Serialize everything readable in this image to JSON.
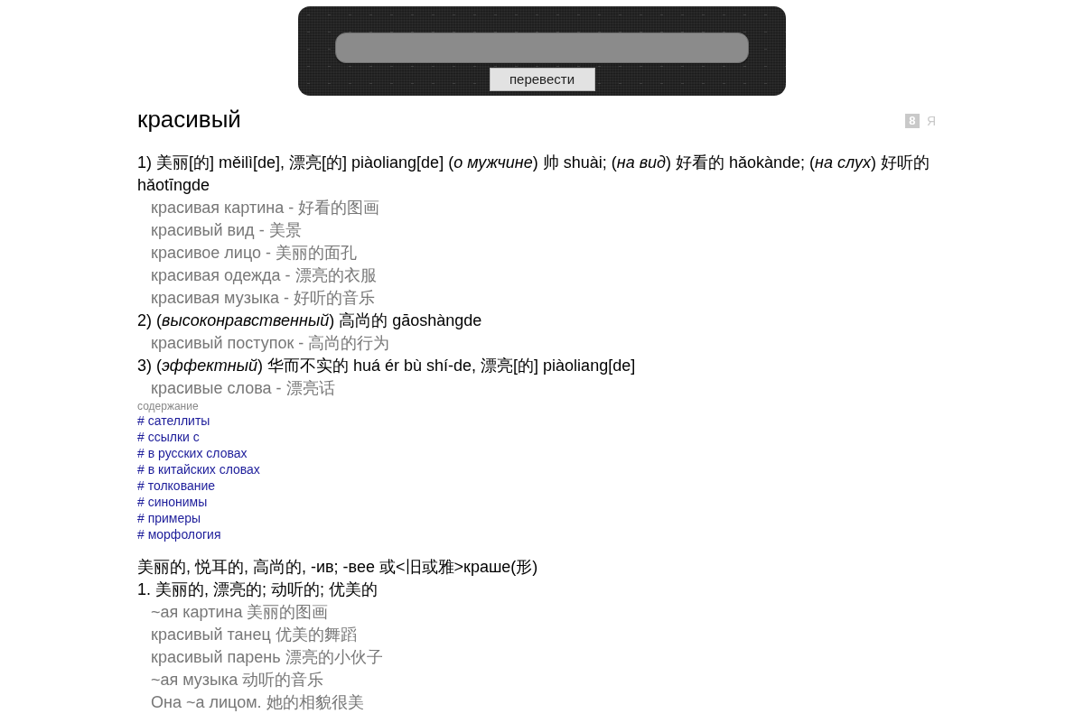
{
  "search_panel": {
    "button": "перевести"
  },
  "headword": "красивый",
  "source_links": [
    {
      "kind": "tile",
      "text": "8"
    },
    {
      "kind": "letter",
      "text": "Я"
    }
  ],
  "senses": [
    {
      "text": "1) 美丽[的] měilì[de], 漂亮[的] piàoliang[de] (*о мужчине*) 帅 shuài; (*на вид*) 好看的 hǎokànde; (*на слух*) 好听的 hǎotīngde",
      "examples": [
        "красивая картина - 好看的图画",
        "красивый вид - 美景",
        "красивое лицо - 美丽的面孔",
        "красивая одежда - 漂亮的衣服",
        "красивая музыка - 好听的音乐"
      ]
    },
    {
      "text": "2) (*высоконравственный*) 高尚的 gāoshàngde",
      "examples": [
        "красивый поступок - 高尚的行为"
      ]
    },
    {
      "text": "3) (*эффектный*) 华而不实的 huá ér bù shí-de, 漂亮[的] piàoliang[de]",
      "examples": [
        "красивые слова - 漂亮话"
      ]
    }
  ],
  "contents": {
    "title": "содержание",
    "links": [
      "# сателлиты",
      "# ссылки с",
      "# в русских словах",
      "# в китайских словах",
      "# толкование",
      "# синонимы",
      "# примеры",
      "# морфология"
    ]
  },
  "article": {
    "header": "美丽的, 悦耳的, 高尚的, -ив; -вее 或<旧或雅>краше(形)",
    "senses": [
      {
        "text": "1. 美丽的, 漂亮的; 动听的; 优美的",
        "examples": [
          "~ая картина 美丽的图画",
          "красивый танец 优美的舞蹈",
          "красивый парень 漂亮的小伙子",
          "~ая музыка 动听的音乐",
          "Она ~а лицом. 她的相貌很美"
        ]
      }
    ]
  }
}
